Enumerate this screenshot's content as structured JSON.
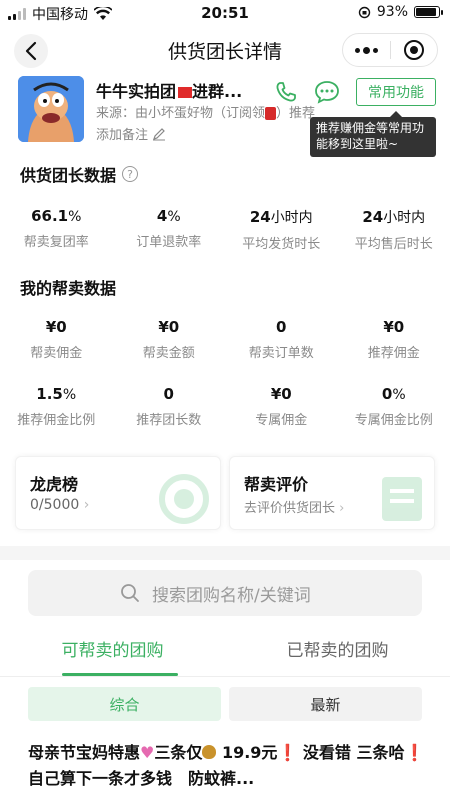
{
  "status_bar": {
    "carrier": "中国移动",
    "time": "20:51",
    "battery": "93%",
    "battery_level": 0.93
  },
  "nav": {
    "title": "供货团长详情"
  },
  "profile": {
    "name": "牛牛实拍团",
    "name_suffix": "进群...",
    "source_prefix": "来源：由小坏蛋好物（订阅领",
    "source_suffix": "）推荐",
    "note": "添加备注",
    "common_button": "常用功能",
    "tooltip": "推荐赚佣金等常用功能移到这里啦~"
  },
  "supplier_stats": {
    "title": "供货团长数据",
    "items": [
      {
        "value": "66.1",
        "unit": "%",
        "label": "帮卖复团率"
      },
      {
        "value": "4",
        "unit": "%",
        "label": "订单退款率"
      },
      {
        "value": "24",
        "unit": "小时内",
        "label": "平均发货时长"
      },
      {
        "value": "24",
        "unit": "小时内",
        "label": "平均售后时长"
      }
    ]
  },
  "my_stats": {
    "title": "我的帮卖数据",
    "row1": [
      {
        "value": "¥0",
        "label": "帮卖佣金"
      },
      {
        "value": "¥0",
        "label": "帮卖金额"
      },
      {
        "value": "0",
        "label": "帮卖订单数"
      },
      {
        "value": "¥0",
        "label": "推荐佣金"
      }
    ],
    "row2": [
      {
        "value": "1.5",
        "unit": "%",
        "label": "推荐佣金比例"
      },
      {
        "value": "0",
        "unit": "",
        "label": "推荐团长数"
      },
      {
        "value": "¥0",
        "unit": "",
        "label": "专属佣金"
      },
      {
        "value": "0",
        "unit": "%",
        "label": "专属佣金比例"
      }
    ]
  },
  "cards": {
    "ranking": {
      "title": "龙虎榜",
      "value": "0/5000"
    },
    "review": {
      "title": "帮卖评价",
      "subtitle": "去评价供货团长"
    }
  },
  "search": {
    "placeholder": "搜索团购名称/关键词"
  },
  "tabs": [
    {
      "label": "可帮卖的团购"
    },
    {
      "label": "已帮卖的团购"
    }
  ],
  "sorts": [
    {
      "label": "综合"
    },
    {
      "label": "最新"
    }
  ],
  "item": {
    "t1": "母亲节宝妈特惠",
    "t2": "三条仅",
    "t3": " 19.9元",
    "t4": " 没看错 三条哈",
    "t5": "自己算下一条才多钱　防蚊裤..."
  },
  "colors": {
    "accent": "#3bb062",
    "tooltip_bg": "#333333"
  }
}
